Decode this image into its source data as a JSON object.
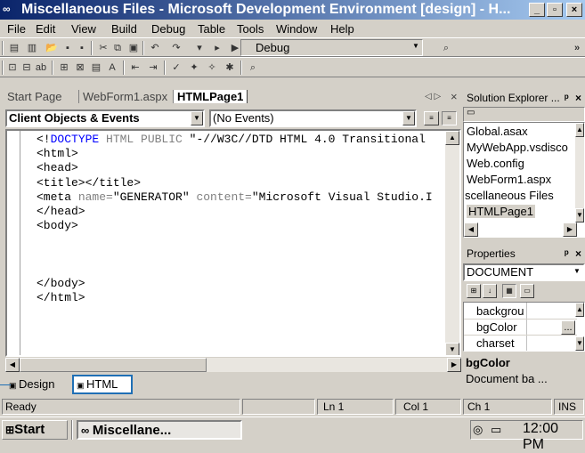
{
  "window": {
    "title": "Miscellaneous Files - Microsoft Development Environment [design] - H...",
    "app_icon": "vs-app-icon",
    "controls": {
      "minimize": "_",
      "maximize": "▫",
      "close": "×"
    }
  },
  "menu": {
    "items": [
      "File",
      "Edit",
      "View",
      "Build",
      "Debug",
      "Table",
      "Tools",
      "Window",
      "Help"
    ]
  },
  "toolbar": {
    "config_value": "Debug",
    "overflow": "»"
  },
  "doc_tabs": {
    "tabs": [
      "Start Page",
      "WebForm1.aspx",
      "HTMLPage1"
    ],
    "active": "HTMLPage1",
    "nav_arrows": "◁ ▷",
    "close": "×"
  },
  "editor": {
    "object_combo": "Client Objects & Events",
    "event_combo": "(No Events)",
    "lines": [
      {
        "parts": [
          [
            "",
            "<!"
          ],
          [
            "blue",
            "DOCTYPE"
          ],
          [
            "gray",
            " HTML PUBLIC "
          ],
          [
            "",
            "\"-//W3C//DTD HTML 4.0 Transitional"
          ]
        ]
      },
      {
        "parts": [
          [
            "",
            "<html>"
          ]
        ]
      },
      {
        "parts": [
          [
            "",
            "<head>"
          ]
        ]
      },
      {
        "parts": [
          [
            "",
            "<title></title>"
          ]
        ]
      },
      {
        "parts": [
          [
            "",
            "<meta "
          ],
          [
            "gray",
            "name="
          ],
          [
            "",
            "\"GENERATOR\" "
          ],
          [
            "gray",
            "content="
          ],
          [
            "",
            "\"Microsoft Visual Studio.I"
          ]
        ]
      },
      {
        "parts": [
          [
            "",
            "</head>"
          ]
        ]
      },
      {
        "parts": [
          [
            "",
            "<body>"
          ]
        ]
      },
      {
        "parts": [
          [
            "",
            ""
          ]
        ]
      },
      {
        "parts": [
          [
            "",
            ""
          ]
        ]
      },
      {
        "parts": [
          [
            "",
            ""
          ]
        ]
      },
      {
        "parts": [
          [
            "",
            "</body>"
          ]
        ]
      },
      {
        "parts": [
          [
            "",
            "</html>"
          ]
        ]
      }
    ],
    "view_tabs": [
      "Design",
      "HTML"
    ],
    "active_view": "HTML"
  },
  "solution_explorer": {
    "title": "Solution Explorer ...",
    "pin": "ᵖ",
    "close": "×",
    "items": [
      "Global.asax",
      "MyWebApp.vsdisco",
      "Web.config",
      "WebForm1.aspx",
      "scellaneous Files",
      "HTMLPage1"
    ],
    "selected": "HTMLPage1"
  },
  "properties": {
    "title": "Properties",
    "pin": "ᵖ",
    "close": "×",
    "object": "DOCUMENT",
    "rows": [
      "backgrou",
      "bgColor",
      "charset"
    ],
    "selected_row": "bgColor",
    "ellipsis": "...",
    "desc_title": "bgColor",
    "desc_text": "Document ba ..."
  },
  "statusbar": {
    "status": "Ready",
    "line": "Ln 1",
    "col": "Col 1",
    "ch": "Ch 1",
    "mode": "INS"
  },
  "taskbar": {
    "start": "Start",
    "task": "Miscellane...",
    "clock": "12:00 PM"
  },
  "colors": {
    "title_gradient_start": "#0a246a",
    "title_gradient_end": "#a6caf0",
    "face": "#d4d0c8",
    "selection": "#d4d0c8",
    "focus_box": "#1f6fb5"
  }
}
